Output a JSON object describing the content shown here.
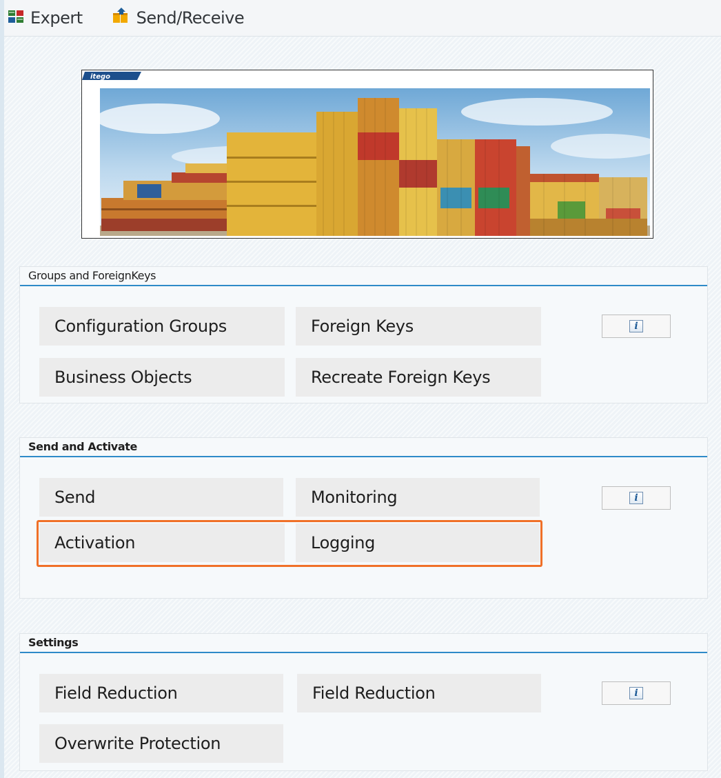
{
  "toolbar": {
    "expert_label": "Expert",
    "send_receive_label": "Send/Receive"
  },
  "banner": {
    "logo_text": "itego"
  },
  "groups": [
    {
      "title": "Groups and ForeignKeys",
      "tiles": [
        "Configuration Groups",
        "Foreign Keys",
        "Business Objects",
        "Recreate Foreign Keys"
      ],
      "info": "i"
    },
    {
      "title": "Send and Activate",
      "tiles": [
        "Send",
        "Monitoring",
        "Activation",
        "Logging"
      ],
      "info": "i"
    },
    {
      "title": "Settings",
      "tiles": [
        "Field Reduction",
        "Field Reduction",
        "Overwrite Protection"
      ],
      "info": "i"
    }
  ],
  "colors": {
    "accent_line": "#2e8ac8",
    "highlight": "#f07028",
    "tile_bg": "#ececec"
  },
  "icons": {
    "expert": "expert-icon",
    "send_receive": "send-receive-icon",
    "info": "info-icon"
  }
}
